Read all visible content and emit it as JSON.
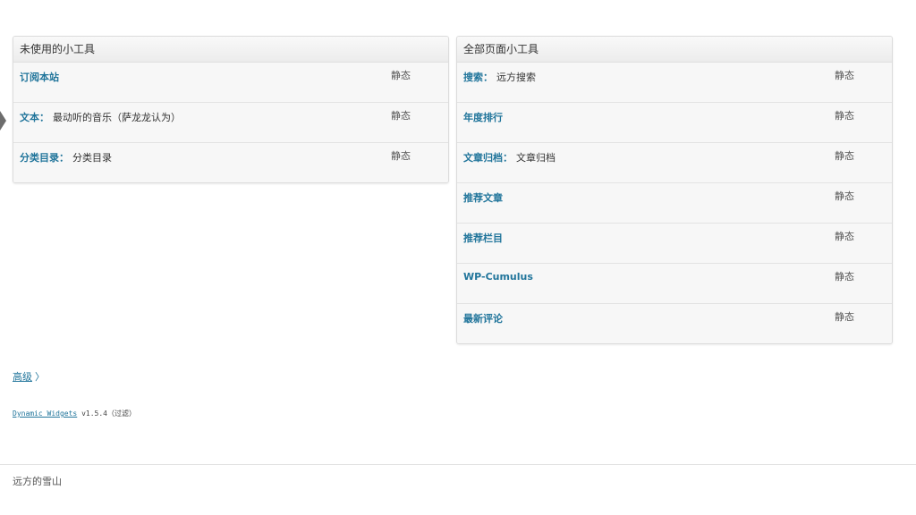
{
  "unused_panel": {
    "title": "未使用的小工具",
    "widgets": [
      {
        "name": "订阅本站",
        "sub": "",
        "status": "静态"
      },
      {
        "name": "文本：",
        "sub": "最动听的音乐（萨龙龙认为）",
        "status": "静态"
      },
      {
        "name": "分类目录：",
        "sub": "分类目录",
        "status": "静态"
      }
    ]
  },
  "all_pages_panel": {
    "title": "全部页面小工具",
    "widgets": [
      {
        "name": "搜索：",
        "sub": "远方搜索",
        "status": "静态"
      },
      {
        "name": "年度排行",
        "sub": "",
        "status": "静态"
      },
      {
        "name": "文章归档：",
        "sub": "文章归档",
        "status": "静态"
      },
      {
        "name": "推荐文章",
        "sub": "",
        "status": "静态"
      },
      {
        "name": "推荐栏目",
        "sub": "",
        "status": "静态"
      },
      {
        "name": "WP-Cumulus",
        "sub": "",
        "status": "静态"
      },
      {
        "name": "最新评论",
        "sub": "",
        "status": "静态"
      }
    ]
  },
  "advanced": {
    "label": "高级",
    "chevron": "〉"
  },
  "plugin_info": {
    "link": "Dynamic Widgets",
    "text": "v1.5.4（过滤）"
  },
  "footer": {
    "site_name": "远方的雪山"
  }
}
